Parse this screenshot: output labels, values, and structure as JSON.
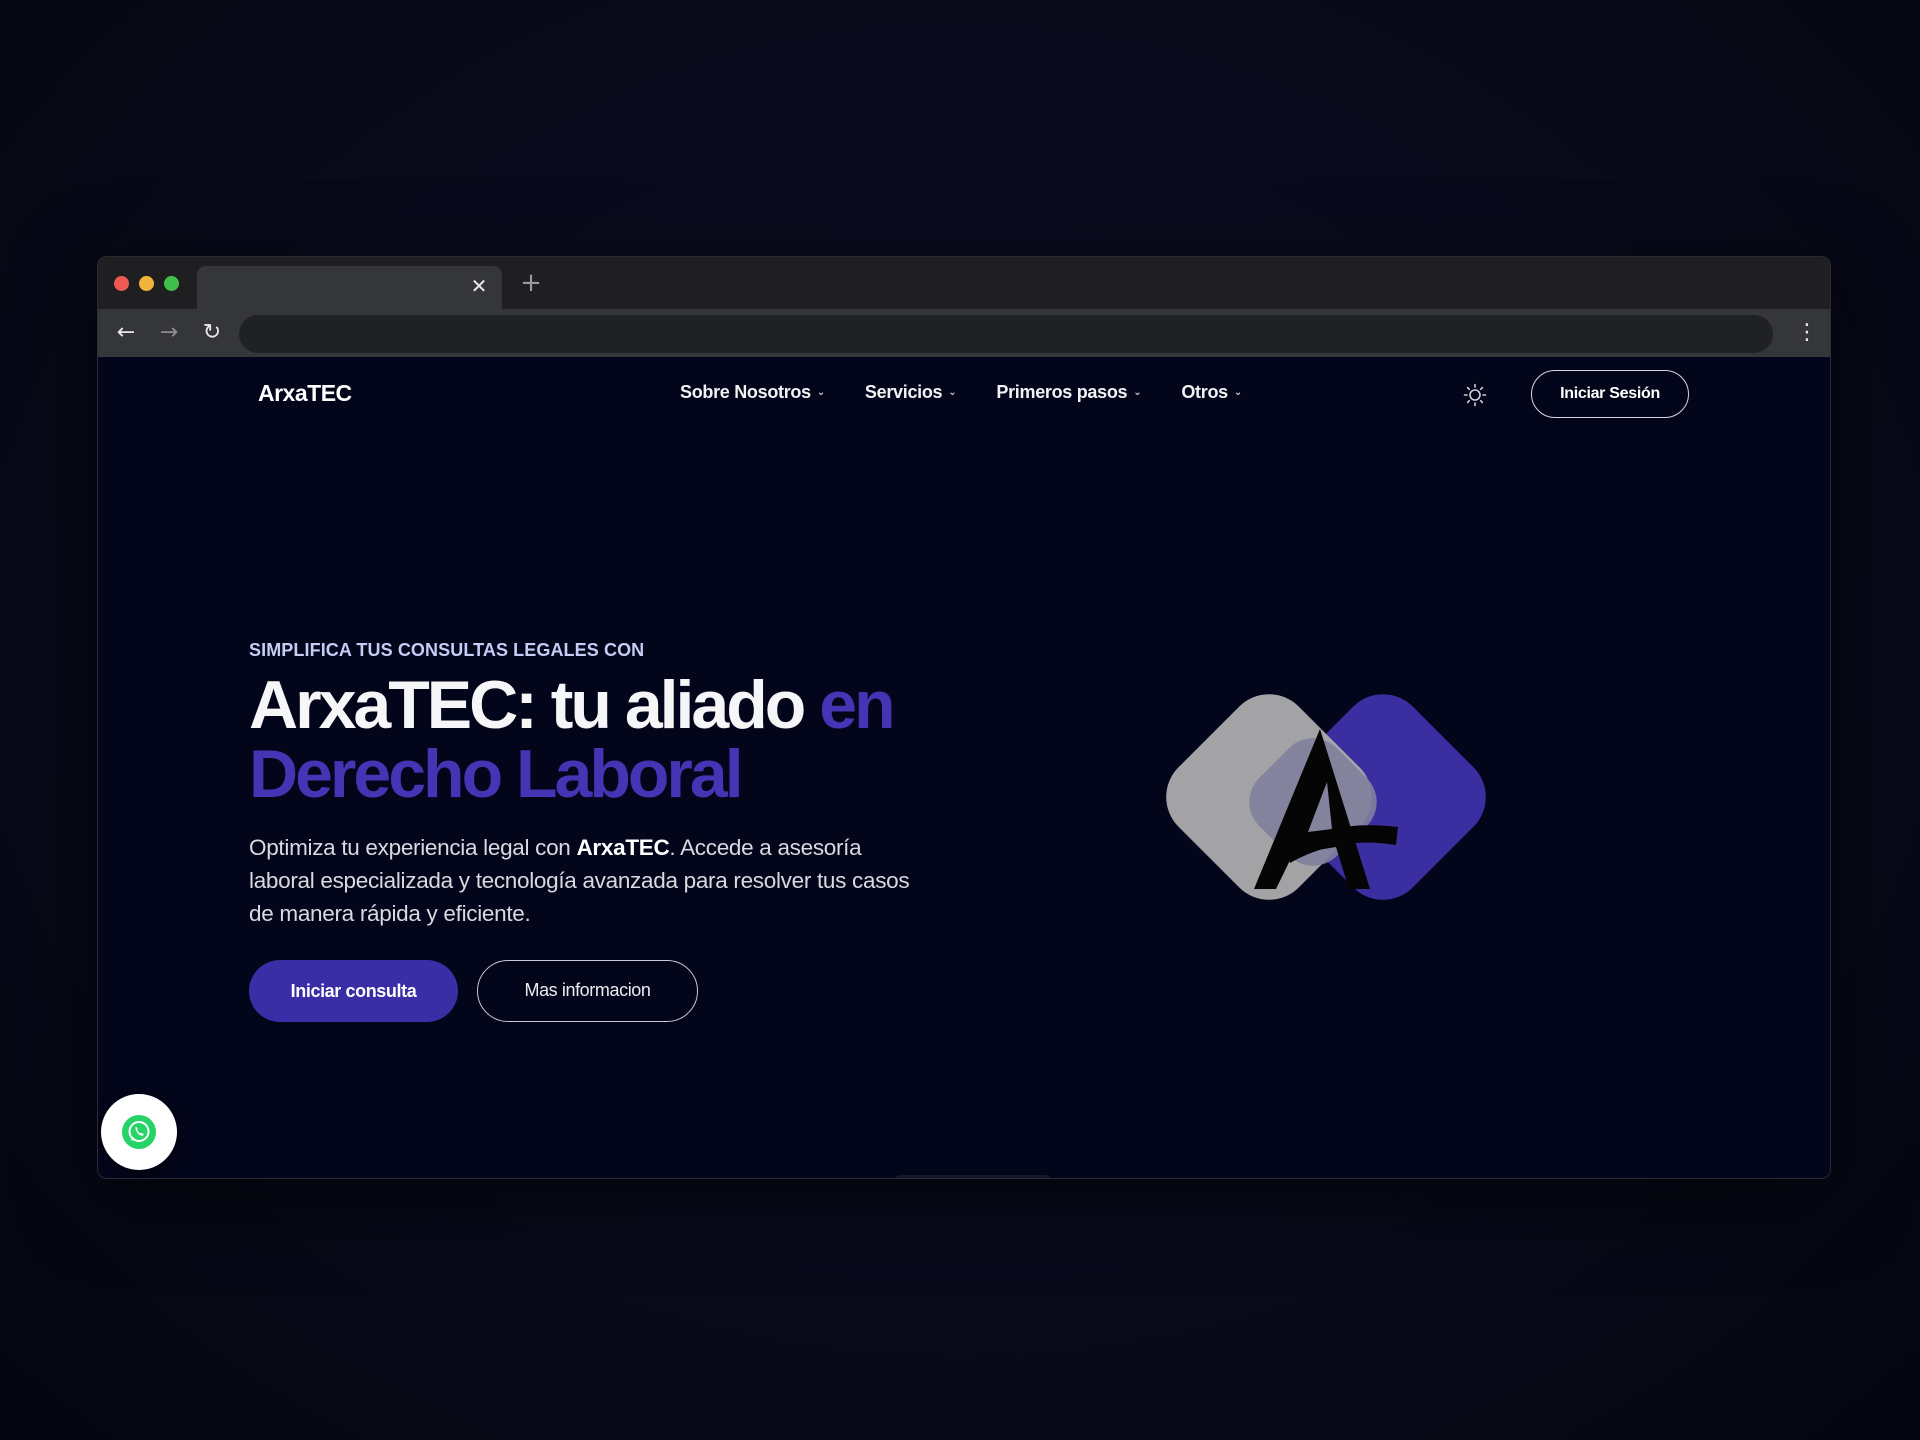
{
  "browser": {
    "tab_close_glyph": "✕",
    "new_tab_glyph": "+",
    "back_glyph": "←",
    "forward_glyph": "→",
    "reload_glyph": "↻",
    "menu_glyph": "⋮",
    "icons": [
      "close-icon",
      "plus-icon",
      "back-arrow-icon",
      "forward-arrow-icon",
      "reload-icon",
      "kebab-menu-icon"
    ]
  },
  "site": {
    "logo": "ArxaTEC",
    "nav": [
      {
        "label": "Sobre Nosotros"
      },
      {
        "label": "Servicios"
      },
      {
        "label": "Primeros pasos"
      },
      {
        "label": "Otros"
      }
    ],
    "chevron_glyph": "⌄",
    "theme_icon": "sun-icon",
    "login_label": "Iniciar Sesión"
  },
  "hero": {
    "eyebrow": "SIMPLIFICA TUS CONSULTAS LEGALES CON",
    "headline_part1": "ArxaTEC: tu aliado ",
    "headline_accent1": "en",
    "headline_accent2": "Derecho Laboral",
    "desc_part1": "Optimiza tu experiencia legal con ",
    "desc_brand": "ArxaTEC",
    "desc_part2": ". Accede a asesoría laboral especializada y tecnología avanzada para resolver tus casos de manera rápida y eficiente.",
    "primary_cta": "Iniciar consulta",
    "secondary_cta": "Mas informacion"
  },
  "colors": {
    "page_bg": "#03051a",
    "accent": "#4734b4",
    "primary_button": "#3a2ea6",
    "logo_gray": "#a8a8aa",
    "logo_violet": "#3b2ea0",
    "whatsapp_green": "#25d366"
  },
  "floating": {
    "whatsapp_icon": "whatsapp-icon"
  }
}
